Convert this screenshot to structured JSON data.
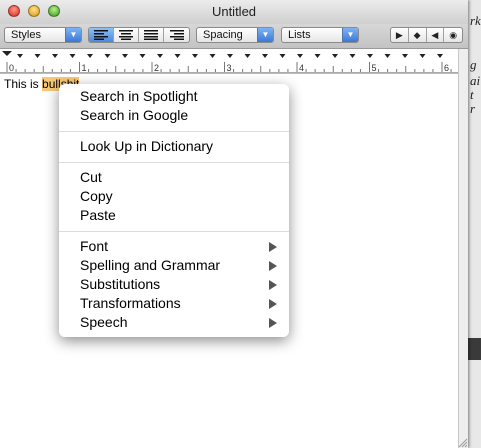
{
  "window": {
    "title": "Untitled"
  },
  "toolbar": {
    "styles_label": "Styles",
    "spacing_label": "Spacing",
    "lists_label": "Lists",
    "align_icons": [
      "align-left-icon",
      "align-center-icon",
      "align-justify-icon",
      "align-right-icon"
    ],
    "tab_icons": [
      "left-tab-icon",
      "center-tab-icon",
      "right-tab-icon",
      "decimal-tab-icon"
    ]
  },
  "ruler": {
    "labels": [
      "0",
      "1",
      "2",
      "3",
      "4",
      "5",
      "6"
    ]
  },
  "document": {
    "text_before": "This is ",
    "text_selected": "bullshit"
  },
  "context_menu": {
    "search_spotlight": "Search in Spotlight",
    "search_google": "Search in Google",
    "look_up": "Look Up in Dictionary",
    "cut": "Cut",
    "copy": "Copy",
    "paste": "Paste",
    "font": "Font",
    "spelling": "Spelling and Grammar",
    "substitutions": "Substitutions",
    "transformations": "Transformations",
    "speech": "Speech"
  },
  "colors": {
    "selection": "#f7c878",
    "accent": "#3a78d8"
  }
}
